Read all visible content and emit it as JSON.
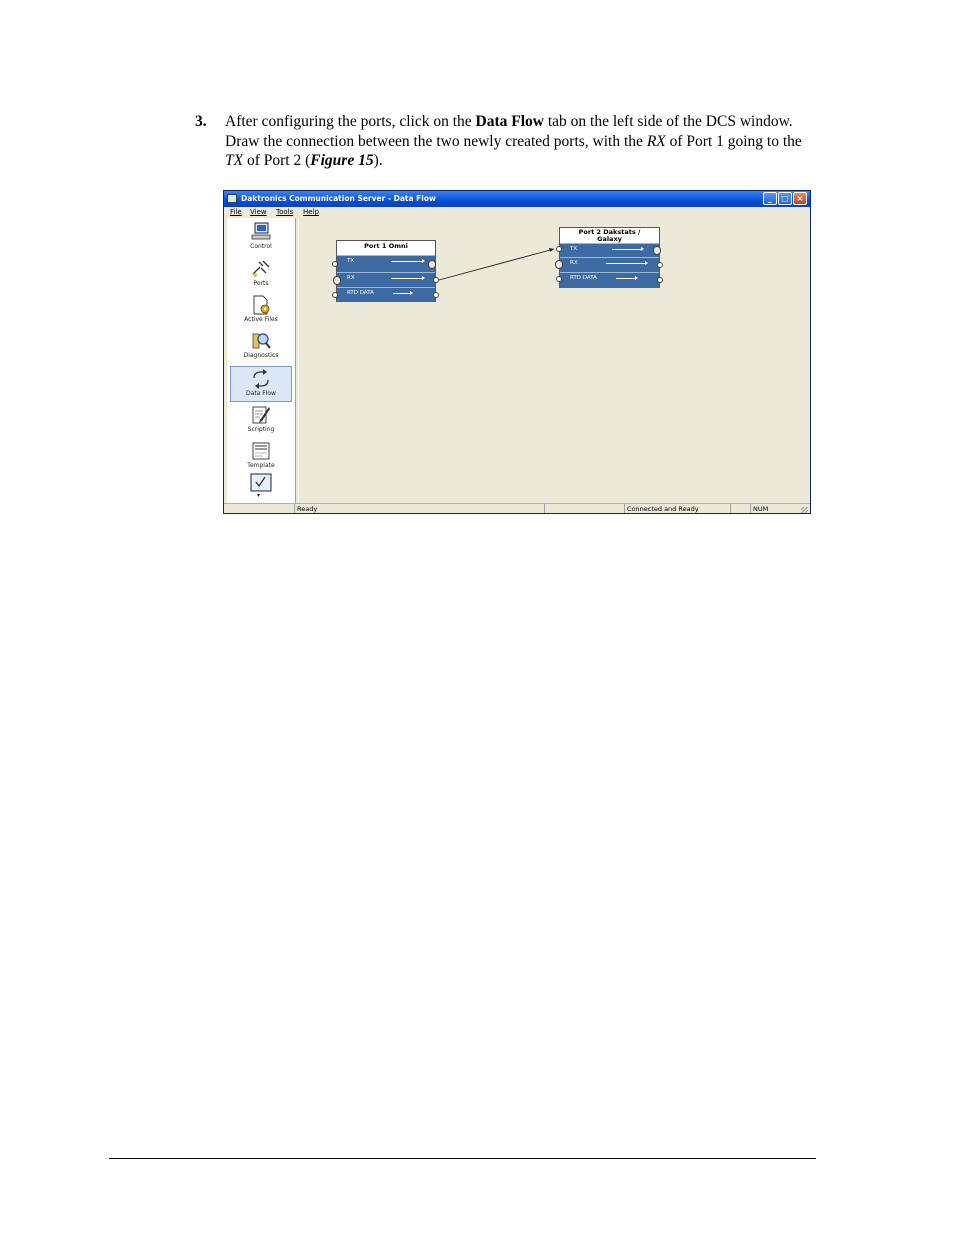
{
  "step": {
    "number": "3.",
    "text_1": "After configuring the ports, click on the ",
    "bold_1": "Data Flow",
    "text_2": " tab on the left side of the DCS window. Draw the connection between the two newly created ports, with the ",
    "italic_1": "RX",
    "text_3": " of Port 1 going to the ",
    "italic_2": "TX",
    "text_4": " of Port 2 (",
    "figure_ref": "Figure 15",
    "text_5": ")."
  },
  "window": {
    "title": "Daktronics Communication Server - Data Flow",
    "menu": [
      "File",
      "View",
      "Tools",
      "Help"
    ],
    "buttons": {
      "minimize": "_",
      "maximize": "□",
      "close": "×"
    },
    "sidebar": [
      {
        "label": "Control",
        "icon": "computer-icon"
      },
      {
        "label": "Ports",
        "icon": "plug-icon"
      },
      {
        "label": "Active Files",
        "icon": "gear-file-icon"
      },
      {
        "label": "Diagnostics",
        "icon": "magnifier-icon"
      },
      {
        "label": "Data Flow",
        "icon": "arrows-icon",
        "active": true
      },
      {
        "label": "Scripting",
        "icon": "pencil-icon"
      },
      {
        "label": "Template",
        "icon": "html-icon"
      },
      {
        "label": "",
        "icon": "checklist-icon"
      }
    ],
    "more_arrow": "▾",
    "port1": {
      "title": "Port 1   Omni",
      "rows": [
        "TX",
        "RX",
        "RTD DATA"
      ]
    },
    "port2": {
      "title_line1": "Port 2   Dakstats /",
      "title_line2": "Galaxy",
      "rows": [
        "TX",
        "RX",
        "RTD DATA"
      ]
    },
    "status": {
      "left": "Ready",
      "connection": "Connected and Ready",
      "num": "NUM"
    },
    "colors": {
      "titlebar": "#0a4fd6",
      "port_row": "#3d6aa3",
      "canvas": "#ece9d8"
    }
  }
}
